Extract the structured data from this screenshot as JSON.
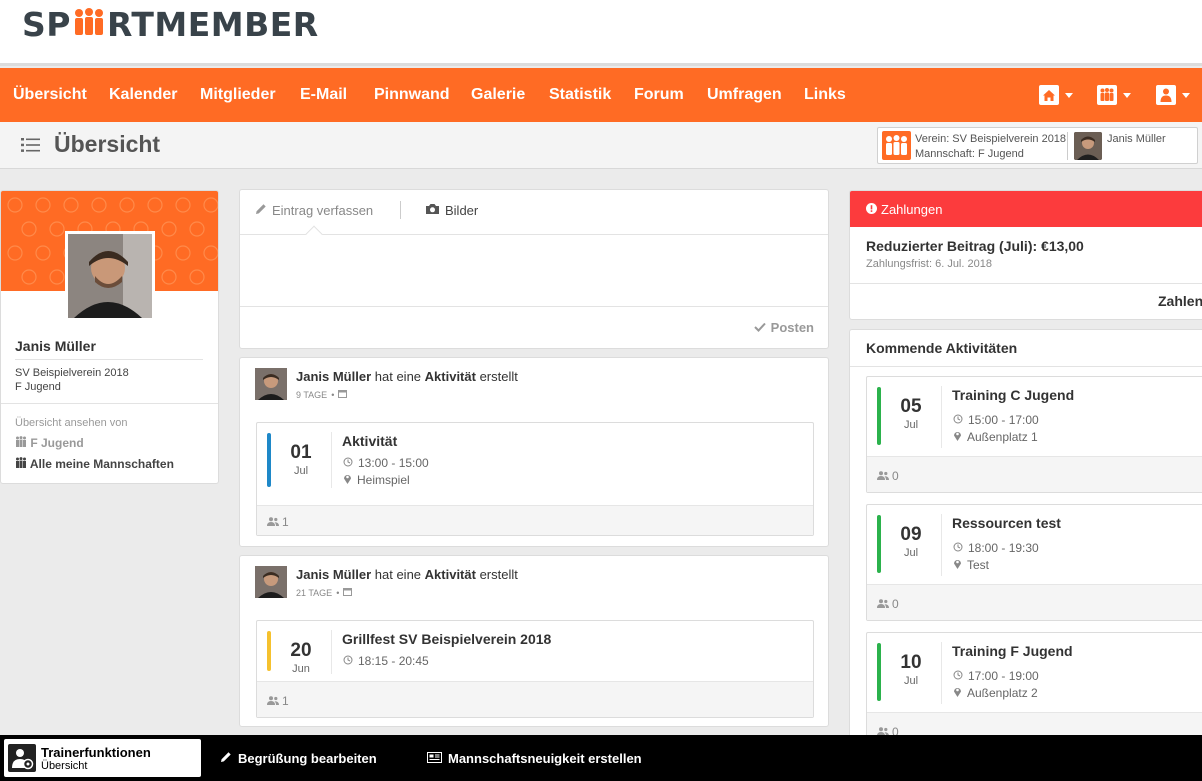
{
  "brand": {
    "name_left": "SP",
    "name_right": "RTMEMBER"
  },
  "nav": {
    "items": [
      "Übersicht",
      "Kalender",
      "Mitglieder",
      "E-Mail",
      "Pinnwand",
      "Galerie",
      "Statistik",
      "Forum",
      "Umfragen",
      "Links"
    ],
    "icons": [
      "home-icon",
      "team-icon",
      "user-icon"
    ]
  },
  "page": {
    "title": "Übersicht"
  },
  "context": {
    "club": "Verein: SV Beispielverein 2018",
    "team": "Mannschaft: F Jugend",
    "user": "Janis Müller"
  },
  "profile": {
    "name": "Janis Müller",
    "club": "SV Beispielverein 2018",
    "team": "F Jugend",
    "view_label": "Übersicht ansehen von",
    "view_team": "F Jugend",
    "view_all": "Alle meine Mannschaften"
  },
  "composer": {
    "tab_write": "Eintrag verfassen",
    "tab_images": "Bilder",
    "post_button": "Posten"
  },
  "feed": [
    {
      "author": "Janis Müller",
      "verb": "hat eine",
      "object": "Aktivität",
      "suffix": "erstellt",
      "ago": "9 TAGE",
      "event": {
        "day": "01",
        "month": "Jul",
        "name": "Aktivität",
        "time": "13:00 - 15:00",
        "place": "Heimspiel",
        "attendees": "1",
        "color": "#1e88c8"
      }
    },
    {
      "author": "Janis Müller",
      "verb": "hat eine",
      "object": "Aktivität",
      "suffix": "erstellt",
      "ago": "21 TAGE",
      "event": {
        "day": "20",
        "month": "Jun",
        "name": "Grillfest SV Beispielverein 2018",
        "time": "18:15 - 20:45",
        "place": "",
        "attendees": "1",
        "color": "#f5c12e"
      }
    }
  ],
  "payments": {
    "header": "Zahlungen",
    "item": "Reduzierter Beitrag (Juli): €13,00",
    "due": "Zahlungsfrist: 6. Jul. 2018",
    "pay_button": "Zahlen"
  },
  "upcoming": {
    "title": "Kommende Aktivitäten",
    "events": [
      {
        "day": "05",
        "month": "Jul",
        "name": "Training C Jugend",
        "time": "15:00 - 17:00",
        "place": "Außenplatz 1",
        "attendees": "0",
        "color": "#2bb24c"
      },
      {
        "day": "09",
        "month": "Jul",
        "name": "Ressourcen test",
        "time": "18:00 - 19:30",
        "place": "Test",
        "attendees": "0",
        "color": "#2bb24c"
      },
      {
        "day": "10",
        "month": "Jul",
        "name": "Training F Jugend",
        "time": "17:00 - 19:00",
        "place": "Außenplatz 2",
        "attendees": "0",
        "color": "#2bb24c"
      }
    ]
  },
  "bottom_bar": {
    "trainer_title": "Trainerfunktionen",
    "trainer_sub": "Übersicht",
    "edit_greeting": "Begrüßung bearbeiten",
    "create_news": "Mannschaftsneuigkeit erstellen"
  },
  "colors": {
    "accent": "#ff6b24",
    "danger": "#fc3b3d",
    "dark": "#39434a"
  }
}
